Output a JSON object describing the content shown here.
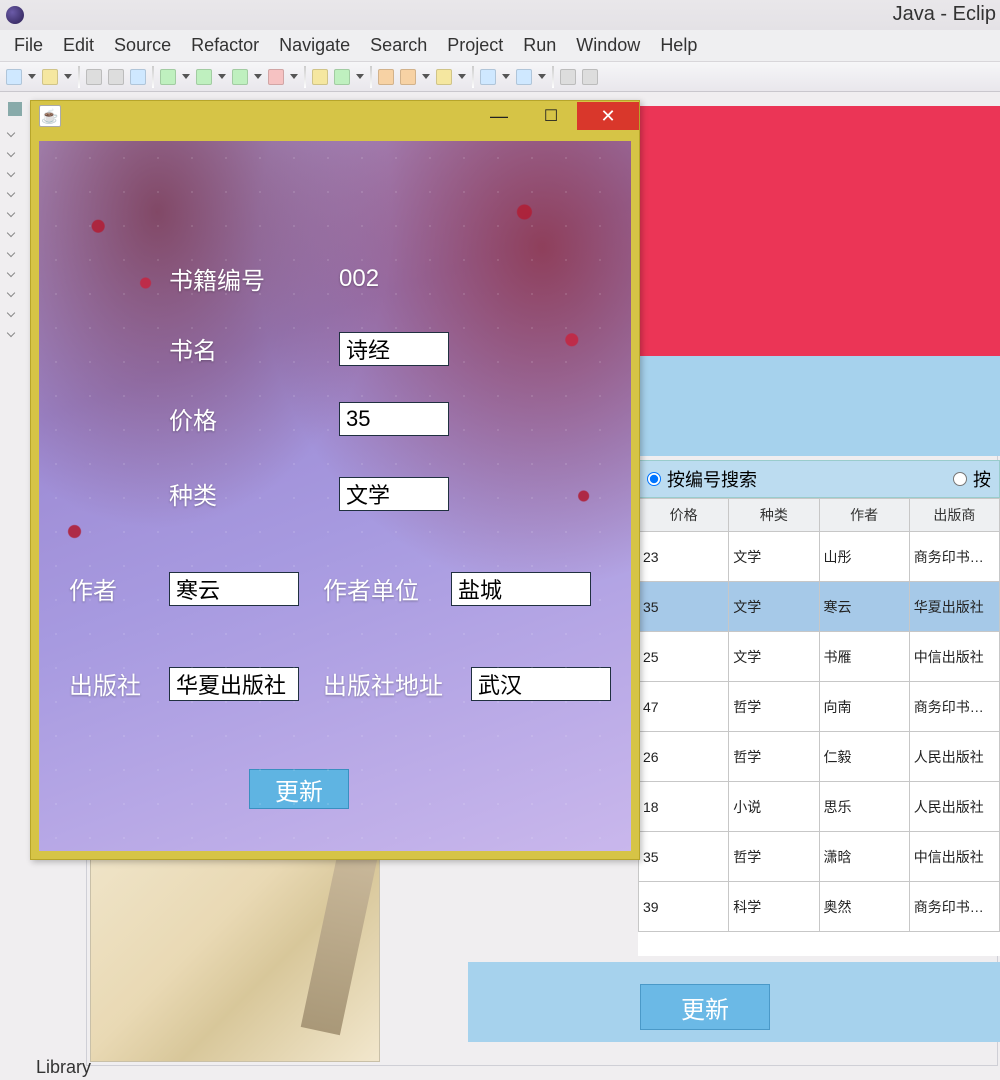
{
  "window": {
    "title": "Java - Eclip"
  },
  "menu": {
    "file": "File",
    "edit": "Edit",
    "source": "Source",
    "refactor": "Refactor",
    "navigate": "Navigate",
    "search": "Search",
    "project": "Project",
    "run": "Run",
    "window": "Window",
    "help": "Help"
  },
  "status": {
    "text": "Library"
  },
  "filter": {
    "opt1": "按编号搜索",
    "opt2": "按"
  },
  "table": {
    "headers": {
      "price": "价格",
      "category": "种类",
      "author": "作者",
      "publisher": "出版商"
    },
    "rows": [
      {
        "price": "23",
        "category": "文学",
        "author": "山彤",
        "publisher": "商务印书出版社",
        "selected": false
      },
      {
        "price": "35",
        "category": "文学",
        "author": "寒云",
        "publisher": "华夏出版社",
        "selected": true
      },
      {
        "price": "25",
        "category": "文学",
        "author": "书雁",
        "publisher": "中信出版社",
        "selected": false
      },
      {
        "price": "47",
        "category": "哲学",
        "author": "向南",
        "publisher": "商务印书出版社",
        "selected": false
      },
      {
        "price": "26",
        "category": "哲学",
        "author": "仁毅",
        "publisher": "人民出版社",
        "selected": false
      },
      {
        "price": "18",
        "category": "小说",
        "author": "思乐",
        "publisher": "人民出版社",
        "selected": false
      },
      {
        "price": "35",
        "category": "哲学",
        "author": "潇晗",
        "publisher": "中信出版社",
        "selected": false
      },
      {
        "price": "39",
        "category": "科学",
        "author": "奥然",
        "publisher": "商务印书出版社",
        "selected": false
      }
    ]
  },
  "main_update_btn": "更新",
  "dialog": {
    "fields": {
      "book_id_label": "书籍编号",
      "book_id_value": "002",
      "name_label": "书名",
      "name_value": "诗经",
      "price_label": "价格",
      "price_value": "35",
      "category_label": "种类",
      "category_value": "文学",
      "author_label": "作者",
      "author_value": "寒云",
      "author_unit_label": "作者单位",
      "author_unit_value": "盐城",
      "publisher_label": "出版社",
      "publisher_value": "华夏出版社",
      "publisher_addr_label": "出版社地址",
      "publisher_addr_value": "武汉"
    },
    "update_btn": "更新"
  }
}
